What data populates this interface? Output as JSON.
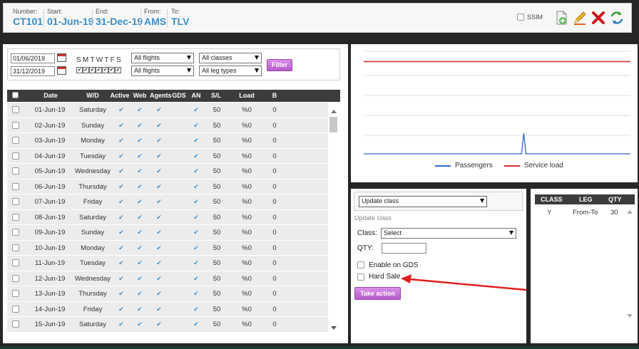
{
  "header": {
    "number_label": "Number:",
    "number": "CT101",
    "start_label": "Start:",
    "start": "01-Jun-19",
    "end_label": "End:",
    "end": "31-Dec-19",
    "from_label": "From:",
    "from": "AMS",
    "to_label": "To:",
    "to": "TLV",
    "ssim_label": "SSIM",
    "icons": [
      "add-document-icon",
      "edit-pencil-icon",
      "delete-x-icon",
      "refresh-arrows-icon"
    ]
  },
  "filter": {
    "date_from": "01/06/2019",
    "date_to": "31/12/2019",
    "weekdays": "SMTWTFS",
    "weekday_checks": [
      "✔",
      "✔",
      "✔",
      "✔",
      "✔",
      "✔",
      "✔"
    ],
    "flights_1": "All flights",
    "flights_2": "All flights",
    "classes": "All classes",
    "leg_types": "All leg types",
    "filter_button": "Filter"
  },
  "table": {
    "columns": [
      "Date",
      "W/D",
      "Active",
      "Web",
      "Agents",
      "GDS",
      "AN",
      "S/L",
      "Load",
      "B"
    ],
    "rows": [
      {
        "date": "01-Jun-19",
        "wd": "Saturday",
        "active": "✔",
        "web": "✔",
        "agents": "✔",
        "gds": "",
        "an": "✔",
        "sl": "50",
        "load": "%0",
        "b": "0"
      },
      {
        "date": "02-Jun-19",
        "wd": "Sunday",
        "active": "✔",
        "web": "✔",
        "agents": "✔",
        "gds": "",
        "an": "✔",
        "sl": "50",
        "load": "%0",
        "b": "0"
      },
      {
        "date": "03-Jun-19",
        "wd": "Monday",
        "active": "✔",
        "web": "✔",
        "agents": "✔",
        "gds": "",
        "an": "✔",
        "sl": "50",
        "load": "%0",
        "b": "0"
      },
      {
        "date": "04-Jun-19",
        "wd": "Tuesday",
        "active": "✔",
        "web": "✔",
        "agents": "✔",
        "gds": "",
        "an": "✔",
        "sl": "50",
        "load": "%0",
        "b": "0"
      },
      {
        "date": "05-Jun-19",
        "wd": "Wednesday",
        "active": "✔",
        "web": "✔",
        "agents": "✔",
        "gds": "",
        "an": "✔",
        "sl": "50",
        "load": "%0",
        "b": "0"
      },
      {
        "date": "06-Jun-19",
        "wd": "Thursday",
        "active": "✔",
        "web": "✔",
        "agents": "✔",
        "gds": "",
        "an": "✔",
        "sl": "50",
        "load": "%0",
        "b": "0"
      },
      {
        "date": "07-Jun-19",
        "wd": "Friday",
        "active": "✔",
        "web": "✔",
        "agents": "✔",
        "gds": "",
        "an": "✔",
        "sl": "50",
        "load": "%0",
        "b": "0"
      },
      {
        "date": "08-Jun-19",
        "wd": "Saturday",
        "active": "✔",
        "web": "✔",
        "agents": "✔",
        "gds": "",
        "an": "✔",
        "sl": "50",
        "load": "%0",
        "b": "0"
      },
      {
        "date": "09-Jun-19",
        "wd": "Sunday",
        "active": "✔",
        "web": "✔",
        "agents": "✔",
        "gds": "",
        "an": "✔",
        "sl": "50",
        "load": "%0",
        "b": "0"
      },
      {
        "date": "10-Jun-19",
        "wd": "Monday",
        "active": "✔",
        "web": "✔",
        "agents": "✔",
        "gds": "",
        "an": "✔",
        "sl": "50",
        "load": "%0",
        "b": "0"
      },
      {
        "date": "11-Jun-19",
        "wd": "Tuesday",
        "active": "✔",
        "web": "✔",
        "agents": "✔",
        "gds": "",
        "an": "✔",
        "sl": "50",
        "load": "%0",
        "b": "0"
      },
      {
        "date": "12-Jun-19",
        "wd": "Wednesday",
        "active": "✔",
        "web": "✔",
        "agents": "✔",
        "gds": "",
        "an": "✔",
        "sl": "50",
        "load": "%0",
        "b": "0"
      },
      {
        "date": "13-Jun-19",
        "wd": "Thursday",
        "active": "✔",
        "web": "✔",
        "agents": "✔",
        "gds": "",
        "an": "✔",
        "sl": "50",
        "load": "%0",
        "b": "0"
      },
      {
        "date": "14-Jun-19",
        "wd": "Friday",
        "active": "✔",
        "web": "✔",
        "agents": "✔",
        "gds": "",
        "an": "✔",
        "sl": "50",
        "load": "%0",
        "b": "0"
      },
      {
        "date": "15-Jun-19",
        "wd": "Saturday",
        "active": "✔",
        "web": "✔",
        "agents": "✔",
        "gds": "",
        "an": "✔",
        "sl": "50",
        "load": "%0",
        "b": "0"
      }
    ]
  },
  "chart_data": {
    "type": "line",
    "title": "",
    "xlabel": "",
    "ylabel": "",
    "grid": true,
    "legend_position": "bottom",
    "series": [
      {
        "name": "Passengers",
        "color": "#3366cc",
        "values": [
          0,
          0,
          0,
          0,
          0,
          0,
          0,
          0,
          0,
          0,
          0,
          0,
          0,
          0,
          0,
          0,
          0,
          0,
          0,
          0,
          0,
          0,
          0,
          0,
          0,
          0,
          0,
          0,
          0,
          0,
          0,
          0,
          0,
          0,
          0,
          0,
          0,
          0,
          0,
          0,
          0,
          0,
          0,
          0,
          0,
          0,
          0,
          0,
          0,
          0,
          0,
          0,
          0,
          0,
          0,
          0,
          0,
          0,
          0,
          0,
          0,
          0,
          0,
          0,
          0,
          0,
          0,
          0,
          0,
          0,
          0,
          0,
          1,
          0,
          0,
          0,
          0,
          0,
          0,
          0,
          0,
          0,
          0,
          0,
          0,
          0,
          0,
          0,
          0,
          0,
          0,
          0,
          0,
          0,
          0,
          0,
          0,
          0,
          0,
          0,
          0,
          0,
          0,
          0,
          0,
          0,
          0,
          0,
          0,
          0,
          0,
          0,
          0,
          0,
          0,
          0,
          0,
          0,
          0,
          0,
          0
        ]
      },
      {
        "name": "Service load",
        "color": "#cc3333",
        "values": [
          4.5,
          4.5
        ]
      }
    ]
  },
  "action": {
    "dropdown": "Update class",
    "subtitle": "Update class",
    "class_label": "Class:",
    "class_value": "Select",
    "qty_label": "QTY:",
    "qty_value": "",
    "gds_label": "Enable on GDS",
    "hard_sale_label": "Hard Sale",
    "button": "Take action",
    "annotation_arrow_color": "#e02020"
  },
  "class_table": {
    "columns": [
      "CLASS",
      "LEG",
      "QTY"
    ],
    "rows": [
      {
        "class": "Y",
        "leg": "From-To",
        "qty": "30"
      }
    ]
  }
}
